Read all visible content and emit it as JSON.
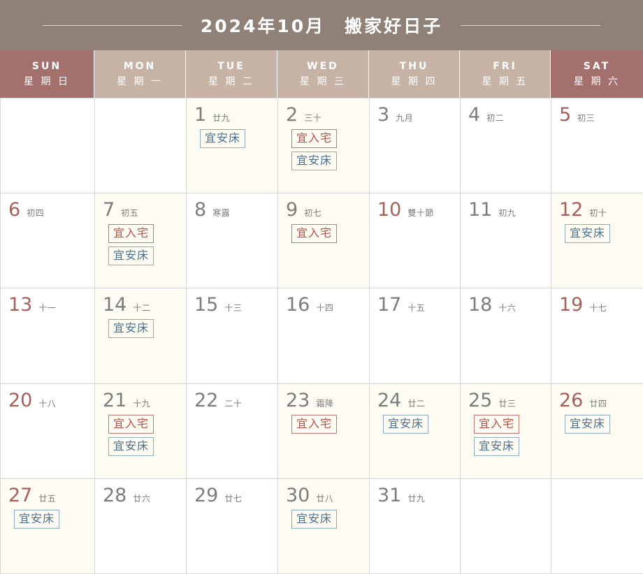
{
  "header": {
    "title": "2024年10月　搬家好日子",
    "rule_left": "decorative-rule",
    "rule_right": "decorative-rule"
  },
  "colors": {
    "title_bar_bg": "#8f8078",
    "weekday_bg": "#c7b3a5",
    "weekend_bg": "#a3706d",
    "cell_tint": "#fdfbf2",
    "cell_plain": "#ffffff",
    "grid_line": "#d8d8d8",
    "day_num": "#7d7d7d",
    "day_num_red": "#a4605a",
    "tag_red": "#b5534a",
    "tag_red_border": "#c07a72",
    "tag_blue": "#4c6f8d",
    "tag_blue_border": "#8fa9bd"
  },
  "weekdays": [
    {
      "en": "SUN",
      "zh": "星 期 日",
      "weekend": true
    },
    {
      "en": "MON",
      "zh": "星 期 一",
      "weekend": false
    },
    {
      "en": "TUE",
      "zh": "星 期 二",
      "weekend": false
    },
    {
      "en": "WED",
      "zh": "星 期 三",
      "weekend": false
    },
    {
      "en": "THU",
      "zh": "星 期 四",
      "weekend": false
    },
    {
      "en": "FRI",
      "zh": "星 期 五",
      "weekend": false
    },
    {
      "en": "SAT",
      "zh": "星 期 六",
      "weekend": true
    }
  ],
  "tag_labels": {
    "move_in": "宜入宅",
    "bed": "宜安床"
  },
  "days": [
    {
      "num": "",
      "lunar": "",
      "red": false,
      "tags": []
    },
    {
      "num": "",
      "lunar": "",
      "red": false,
      "tags": []
    },
    {
      "num": "1",
      "lunar": "廿九",
      "red": false,
      "tags": [
        {
          "label": "宜安床",
          "color": "blue"
        }
      ]
    },
    {
      "num": "2",
      "lunar": "三十",
      "red": false,
      "tags": [
        {
          "label": "宜入宅",
          "color": "red"
        },
        {
          "label": "宜安床",
          "color": "blue"
        }
      ]
    },
    {
      "num": "3",
      "lunar": "九月",
      "red": false,
      "tags": []
    },
    {
      "num": "4",
      "lunar": "初二",
      "red": false,
      "tags": []
    },
    {
      "num": "5",
      "lunar": "初三",
      "red": true,
      "tags": []
    },
    {
      "num": "6",
      "lunar": "初四",
      "red": true,
      "tags": []
    },
    {
      "num": "7",
      "lunar": "初五",
      "red": false,
      "tags": [
        {
          "label": "宜入宅",
          "color": "red"
        },
        {
          "label": "宜安床",
          "color": "blue"
        }
      ]
    },
    {
      "num": "8",
      "lunar": "寒露",
      "red": false,
      "tags": []
    },
    {
      "num": "9",
      "lunar": "初七",
      "red": false,
      "tags": [
        {
          "label": "宜入宅",
          "color": "red"
        }
      ]
    },
    {
      "num": "10",
      "lunar": "雙十節",
      "red": true,
      "tags": []
    },
    {
      "num": "11",
      "lunar": "初九",
      "red": false,
      "tags": []
    },
    {
      "num": "12",
      "lunar": "初十",
      "red": true,
      "tags": [
        {
          "label": "宜安床",
          "color": "blue"
        }
      ]
    },
    {
      "num": "13",
      "lunar": "十一",
      "red": true,
      "tags": []
    },
    {
      "num": "14",
      "lunar": "十二",
      "red": false,
      "tags": [
        {
          "label": "宜安床",
          "color": "blue"
        }
      ]
    },
    {
      "num": "15",
      "lunar": "十三",
      "red": false,
      "tags": []
    },
    {
      "num": "16",
      "lunar": "十四",
      "red": false,
      "tags": []
    },
    {
      "num": "17",
      "lunar": "十五",
      "red": false,
      "tags": []
    },
    {
      "num": "18",
      "lunar": "十六",
      "red": false,
      "tags": []
    },
    {
      "num": "19",
      "lunar": "十七",
      "red": true,
      "tags": []
    },
    {
      "num": "20",
      "lunar": "十八",
      "red": true,
      "tags": []
    },
    {
      "num": "21",
      "lunar": "十九",
      "red": false,
      "tags": [
        {
          "label": "宜入宅",
          "color": "red"
        },
        {
          "label": "宜安床",
          "color": "blue"
        }
      ]
    },
    {
      "num": "22",
      "lunar": "二十",
      "red": false,
      "tags": []
    },
    {
      "num": "23",
      "lunar": "霜降",
      "red": false,
      "tags": [
        {
          "label": "宜入宅",
          "color": "red"
        }
      ]
    },
    {
      "num": "24",
      "lunar": "廿二",
      "red": false,
      "tags": [
        {
          "label": "宜安床",
          "color": "blue"
        }
      ]
    },
    {
      "num": "25",
      "lunar": "廿三",
      "red": false,
      "tags": [
        {
          "label": "宜入宅",
          "color": "red"
        },
        {
          "label": "宜安床",
          "color": "blue"
        }
      ]
    },
    {
      "num": "26",
      "lunar": "廿四",
      "red": true,
      "tags": [
        {
          "label": "宜安床",
          "color": "blue"
        }
      ]
    },
    {
      "num": "27",
      "lunar": "廿五",
      "red": true,
      "tags": [
        {
          "label": "宜安床",
          "color": "blue"
        }
      ]
    },
    {
      "num": "28",
      "lunar": "廿六",
      "red": false,
      "tags": []
    },
    {
      "num": "29",
      "lunar": "廿七",
      "red": false,
      "tags": []
    },
    {
      "num": "30",
      "lunar": "廿八",
      "red": false,
      "tags": [
        {
          "label": "宜安床",
          "color": "blue"
        }
      ]
    },
    {
      "num": "31",
      "lunar": "廿九",
      "red": false,
      "tags": []
    },
    {
      "num": "",
      "lunar": "",
      "red": false,
      "tags": []
    },
    {
      "num": "",
      "lunar": "",
      "red": false,
      "tags": []
    }
  ]
}
